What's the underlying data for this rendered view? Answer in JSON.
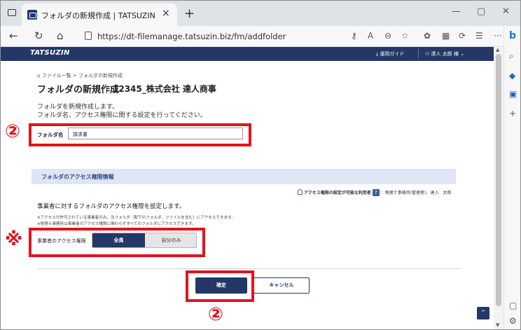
{
  "browser": {
    "tab_title": "フォルダの新規作成 | TATSUZIN",
    "tab_close": "×",
    "new_tab": "+",
    "url": "https://dt-filemanage.tatsuzin.biz/fm/addfolder",
    "win_min": "—",
    "win_max": "▢",
    "win_close": "✕",
    "nav_icons": [
      "back-arrow-icon",
      "reload-icon",
      "home-icon"
    ],
    "more": "···"
  },
  "header": {
    "brand": "TATSUZIN",
    "guide_label": "運用ガイド",
    "user_label": "達人 太郎 様"
  },
  "page": {
    "breadcrumb": "ファイル一覧 > フォルダの新規作成",
    "title": "フォルダの新規作成",
    "company": "12345_株式会社 達人商事",
    "desc1": "フォルダを新規作成します。",
    "desc2": "フォルダ名、アクセス権限に関する設定を行ってください。",
    "folder_label": "フォルダ名",
    "folder_value": "請求書",
    "section_title": "フォルダのアクセス権限情報",
    "perm_user_label": "アクセス権限の設定が可能な利用者",
    "perm_user_value": "：税理士事務所(管理者)、達人　太郎",
    "set_desc": "事業者に対するフォルダのアクセス権限を設定します。",
    "note1": "※アクセスが許可されている事業者のみ、当フォルダ（配下のフォルダ、ファイルを含む）にアクセスできます。",
    "note2": "※税理士事務所は事業者のアクセス権限に関わらずすべてのフォルダにアクセスできます。",
    "access_label": "事業者のアクセス権限",
    "option_all": "全員",
    "option_self": "自分のみ",
    "ok_label": "確定",
    "cancel_label": "キャンセル"
  },
  "annotations": {
    "mark_folder": "②",
    "mark_access": "※",
    "mark_confirm": "②",
    "color": "#e1141c"
  },
  "colors": {
    "brand_navy": "#243766",
    "section_bg": "#dde6f2"
  }
}
